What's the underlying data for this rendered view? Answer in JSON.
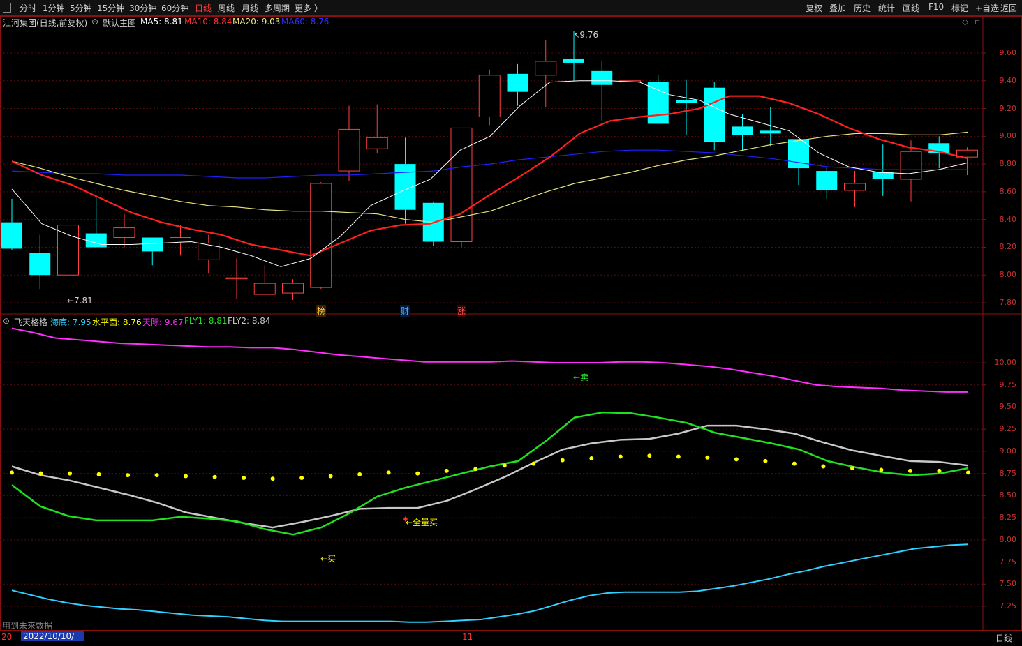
{
  "toolbar": {
    "periods": [
      "分时",
      "1分钟",
      "5分钟",
      "15分钟",
      "30分钟",
      "60分钟",
      "日线",
      "周线",
      "月线",
      "多周期",
      "更多 〉"
    ],
    "active_period": "日线",
    "right_buttons": [
      "复权",
      "叠加",
      "历史",
      "统计",
      "画线",
      "F10",
      "标记",
      "+自选",
      "返回"
    ]
  },
  "main_header": {
    "stock": "江河集团(日线,前复权)",
    "template": "默认主图",
    "ma5": "MA5: 8.81",
    "ma10": "MA10: 8.84",
    "ma20": "MA20: 9.03",
    "ma60": "MA60: 8.76"
  },
  "sub_header": {
    "name": "飞天格格",
    "haidi": "海底: 7.95",
    "shuiping": "水平面: 8.76",
    "tianji": "天际: 9.67",
    "fly1": "FLY1: 8.81",
    "fly2": "FLY2: 8.84"
  },
  "main_axis": [
    "9.60",
    "9.40",
    "9.20",
    "9.00",
    "8.80",
    "8.60",
    "8.40",
    "8.20",
    "8.00",
    "7.80"
  ],
  "sub_axis": [
    "10.00",
    "9.75",
    "9.50",
    "9.25",
    "9.00",
    "8.75",
    "8.50",
    "8.25",
    "8.00",
    "7.75",
    "7.50",
    "7.25"
  ],
  "annotations": {
    "low": "←7.81",
    "high": "9.76",
    "bang": "榜",
    "cai": "财",
    "zhang": "涨",
    "sell": "←卖",
    "buy": "←买",
    "full_buy": "←全量买",
    "future_data": "用到未来数据"
  },
  "bottom": {
    "date": "2022/10/10/一",
    "month_mark": "11",
    "left_mark": "20",
    "period_label": "日线"
  },
  "colors": {
    "up": "#ff4040",
    "down": "#00ffff",
    "ma5": "#ffffff",
    "ma10": "#ff2020",
    "ma20": "#e6e680",
    "ma60": "#2020ff",
    "tianji": "#ff30ff",
    "fly1": "#20e020",
    "fly2": "#c8c8c8",
    "haidi": "#30d0ff",
    "shuiping": "#ffff00"
  },
  "chart_data": {
    "type": "candlestick",
    "candles": [
      {
        "o": 8.38,
        "h": 8.55,
        "l": 8.18,
        "c": 8.19
      },
      {
        "o": 8.16,
        "h": 8.29,
        "l": 7.9,
        "c": 8.0
      },
      {
        "o": 8.0,
        "h": 8.36,
        "l": 7.81,
        "c": 8.36
      },
      {
        "o": 8.3,
        "h": 8.57,
        "l": 8.2,
        "c": 8.2
      },
      {
        "o": 8.27,
        "h": 8.44,
        "l": 8.2,
        "c": 8.34
      },
      {
        "o": 8.27,
        "h": 8.27,
        "l": 8.07,
        "c": 8.17
      },
      {
        "o": 8.23,
        "h": 8.36,
        "l": 8.14,
        "c": 8.27
      },
      {
        "o": 8.11,
        "h": 8.29,
        "l": 8.01,
        "c": 8.23
      },
      {
        "o": 7.98,
        "h": 8.12,
        "l": 7.83,
        "c": 7.98
      },
      {
        "o": 7.86,
        "h": 8.07,
        "l": 7.86,
        "c": 7.94
      },
      {
        "o": 7.87,
        "h": 7.97,
        "l": 7.82,
        "c": 7.94
      },
      {
        "o": 7.91,
        "h": 8.67,
        "l": 7.9,
        "c": 8.66
      },
      {
        "o": 8.75,
        "h": 9.22,
        "l": 8.68,
        "c": 9.05
      },
      {
        "o": 8.91,
        "h": 9.23,
        "l": 8.88,
        "c": 8.99
      },
      {
        "o": 8.8,
        "h": 8.99,
        "l": 8.37,
        "c": 8.47
      },
      {
        "o": 8.52,
        "h": 8.53,
        "l": 8.21,
        "c": 8.24
      },
      {
        "o": 8.24,
        "h": 9.06,
        "l": 8.2,
        "c": 9.06
      },
      {
        "o": 9.14,
        "h": 9.48,
        "l": 9.08,
        "c": 9.44
      },
      {
        "o": 9.45,
        "h": 9.52,
        "l": 9.22,
        "c": 9.32
      },
      {
        "o": 9.44,
        "h": 9.69,
        "l": 9.21,
        "c": 9.54
      },
      {
        "o": 9.56,
        "h": 9.76,
        "l": 9.4,
        "c": 9.53
      },
      {
        "o": 9.47,
        "h": 9.54,
        "l": 9.11,
        "c": 9.37
      },
      {
        "o": 9.4,
        "h": 9.46,
        "l": 9.25,
        "c": 9.4
      },
      {
        "o": 9.39,
        "h": 9.44,
        "l": 9.09,
        "c": 9.09
      },
      {
        "o": 9.26,
        "h": 9.41,
        "l": 9.01,
        "c": 9.24
      },
      {
        "o": 9.35,
        "h": 9.39,
        "l": 8.9,
        "c": 8.96
      },
      {
        "o": 9.07,
        "h": 9.16,
        "l": 8.9,
        "c": 9.01
      },
      {
        "o": 9.04,
        "h": 9.21,
        "l": 8.93,
        "c": 9.02
      },
      {
        "o": 8.98,
        "h": 8.98,
        "l": 8.65,
        "c": 8.77
      },
      {
        "o": 8.75,
        "h": 8.78,
        "l": 8.55,
        "c": 8.61
      },
      {
        "o": 8.61,
        "h": 8.75,
        "l": 8.49,
        "c": 8.66
      },
      {
        "o": 8.74,
        "h": 8.94,
        "l": 8.57,
        "c": 8.69
      },
      {
        "o": 8.69,
        "h": 8.97,
        "l": 8.53,
        "c": 8.89
      },
      {
        "o": 8.95,
        "h": 9.0,
        "l": 8.77,
        "c": 8.88
      },
      {
        "o": 8.85,
        "h": 8.92,
        "l": 8.72,
        "c": 8.9
      }
    ],
    "ma5": [
      8.62,
      8.37,
      8.28,
      8.22,
      8.22,
      8.23,
      8.24,
      8.2,
      8.14,
      8.06,
      8.12,
      8.28,
      8.5,
      8.6,
      8.69,
      8.9,
      9.0,
      9.22,
      9.39,
      9.4,
      9.4,
      9.39,
      9.3,
      9.26,
      9.16,
      9.1,
      9.04,
      8.88,
      8.78,
      8.74,
      8.73,
      8.76,
      8.81
    ],
    "ma10": [
      8.82,
      8.72,
      8.65,
      8.55,
      8.45,
      8.38,
      8.33,
      8.29,
      8.22,
      8.18,
      8.14,
      8.23,
      8.32,
      8.36,
      8.37,
      8.44,
      8.58,
      8.71,
      8.85,
      9.02,
      9.11,
      9.14,
      9.16,
      9.2,
      9.29,
      9.29,
      9.24,
      9.16,
      9.06,
      8.98,
      8.92,
      8.89,
      8.84
    ],
    "ma20": [
      8.82,
      8.77,
      8.71,
      8.66,
      8.61,
      8.57,
      8.53,
      8.5,
      8.49,
      8.47,
      8.46,
      8.46,
      8.45,
      8.44,
      8.4,
      8.38,
      8.42,
      8.46,
      8.53,
      8.6,
      8.66,
      8.7,
      8.74,
      8.79,
      8.83,
      8.86,
      8.9,
      8.94,
      8.97,
      9.0,
      9.02,
      9.02,
      9.01,
      9.01,
      9.03
    ],
    "ma60": [
      8.75,
      8.74,
      8.73,
      8.73,
      8.72,
      8.72,
      8.72,
      8.71,
      8.7,
      8.7,
      8.71,
      8.72,
      8.72,
      8.73,
      8.74,
      8.75,
      8.78,
      8.8,
      8.83,
      8.85,
      8.87,
      8.89,
      8.9,
      8.9,
      8.89,
      8.88,
      8.86,
      8.84,
      8.81,
      8.78,
      8.77,
      8.76,
      8.76,
      8.76,
      8.76
    ],
    "tianji": [
      10.39,
      10.34,
      10.28,
      10.26,
      10.24,
      10.22,
      10.21,
      10.2,
      10.19,
      10.18,
      10.18,
      10.17,
      10.17,
      10.15,
      10.12,
      10.09,
      10.07,
      10.05,
      10.03,
      10.01,
      10.01,
      10.01,
      10.01,
      10.02,
      10.01,
      10.0,
      10.0,
      10.0,
      10.01,
      10.01,
      10.0,
      9.98,
      9.96,
      9.93,
      9.89,
      9.85,
      9.8,
      9.75,
      9.73,
      9.72,
      9.71,
      9.69,
      9.68,
      9.67,
      9.67
    ],
    "fly1": [
      8.62,
      8.38,
      8.27,
      8.22,
      8.22,
      8.22,
      8.26,
      8.24,
      8.21,
      8.12,
      8.06,
      8.14,
      8.3,
      8.49,
      8.59,
      8.67,
      8.75,
      8.83,
      8.89,
      9.12,
      9.38,
      9.44,
      9.43,
      9.38,
      9.32,
      9.21,
      9.15,
      9.09,
      9.02,
      8.89,
      8.82,
      8.76,
      8.73,
      8.75,
      8.81
    ],
    "fly2": [
      8.83,
      8.73,
      8.67,
      8.59,
      8.51,
      8.42,
      8.31,
      8.25,
      8.19,
      8.14,
      8.2,
      8.27,
      8.35,
      8.36,
      8.36,
      8.44,
      8.57,
      8.71,
      8.87,
      9.02,
      9.09,
      9.13,
      9.14,
      9.2,
      9.29,
      9.29,
      9.25,
      9.2,
      9.1,
      9.01,
      8.95,
      8.89,
      8.88,
      8.84
    ],
    "shuiping": [
      8.76,
      8.75,
      8.75,
      8.74,
      8.73,
      8.73,
      8.72,
      8.71,
      8.7,
      8.69,
      8.7,
      8.72,
      8.74,
      8.76,
      8.75,
      8.78,
      8.8,
      8.84,
      8.86,
      8.9,
      8.92,
      8.94,
      8.95,
      8.94,
      8.93,
      8.91,
      8.89,
      8.86,
      8.83,
      8.81,
      8.79,
      8.78,
      8.78,
      8.76
    ],
    "haidi": [
      7.43,
      7.38,
      7.33,
      7.29,
      7.26,
      7.24,
      7.22,
      7.21,
      7.19,
      7.17,
      7.15,
      7.14,
      7.13,
      7.11,
      7.09,
      7.08,
      7.08,
      7.08,
      7.08,
      7.08,
      7.08,
      7.08,
      7.07,
      7.07,
      7.08,
      7.09,
      7.1,
      7.13,
      7.16,
      7.2,
      7.26,
      7.32,
      7.37,
      7.4,
      7.41,
      7.41,
      7.41,
      7.41,
      7.42,
      7.45,
      7.48,
      7.52,
      7.56,
      7.61,
      7.65,
      7.7,
      7.74,
      7.78,
      7.82,
      7.86,
      7.9,
      7.92,
      7.94,
      7.95
    ]
  }
}
